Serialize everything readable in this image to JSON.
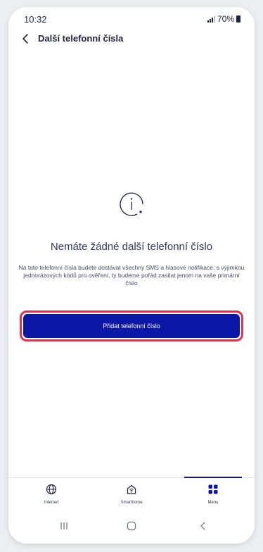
{
  "status": {
    "time": "10:32",
    "battery": "70%"
  },
  "header": {
    "title": "Další telefonní čísla"
  },
  "empty_state": {
    "title": "Nemáte žádné další telefonní číslo",
    "description": "Na tato telefonní čísla budete dostávat všechny SMS a hlasové notifikace, s výjimkou jednorázových kódů pro ověření, ty budeme pořád zasílat jenom na vaše primární číslo"
  },
  "cta": {
    "label": "Přidat telefonní číslo"
  },
  "bottom_nav": {
    "items": [
      {
        "label": "Internet",
        "icon": "globe-icon"
      },
      {
        "label": "Smarthome",
        "icon": "smarthome-icon"
      },
      {
        "label": "Menu",
        "icon": "grid-icon",
        "active": true
      }
    ]
  },
  "colors": {
    "accent": "#0b17a6",
    "highlight": "#e2324f"
  }
}
